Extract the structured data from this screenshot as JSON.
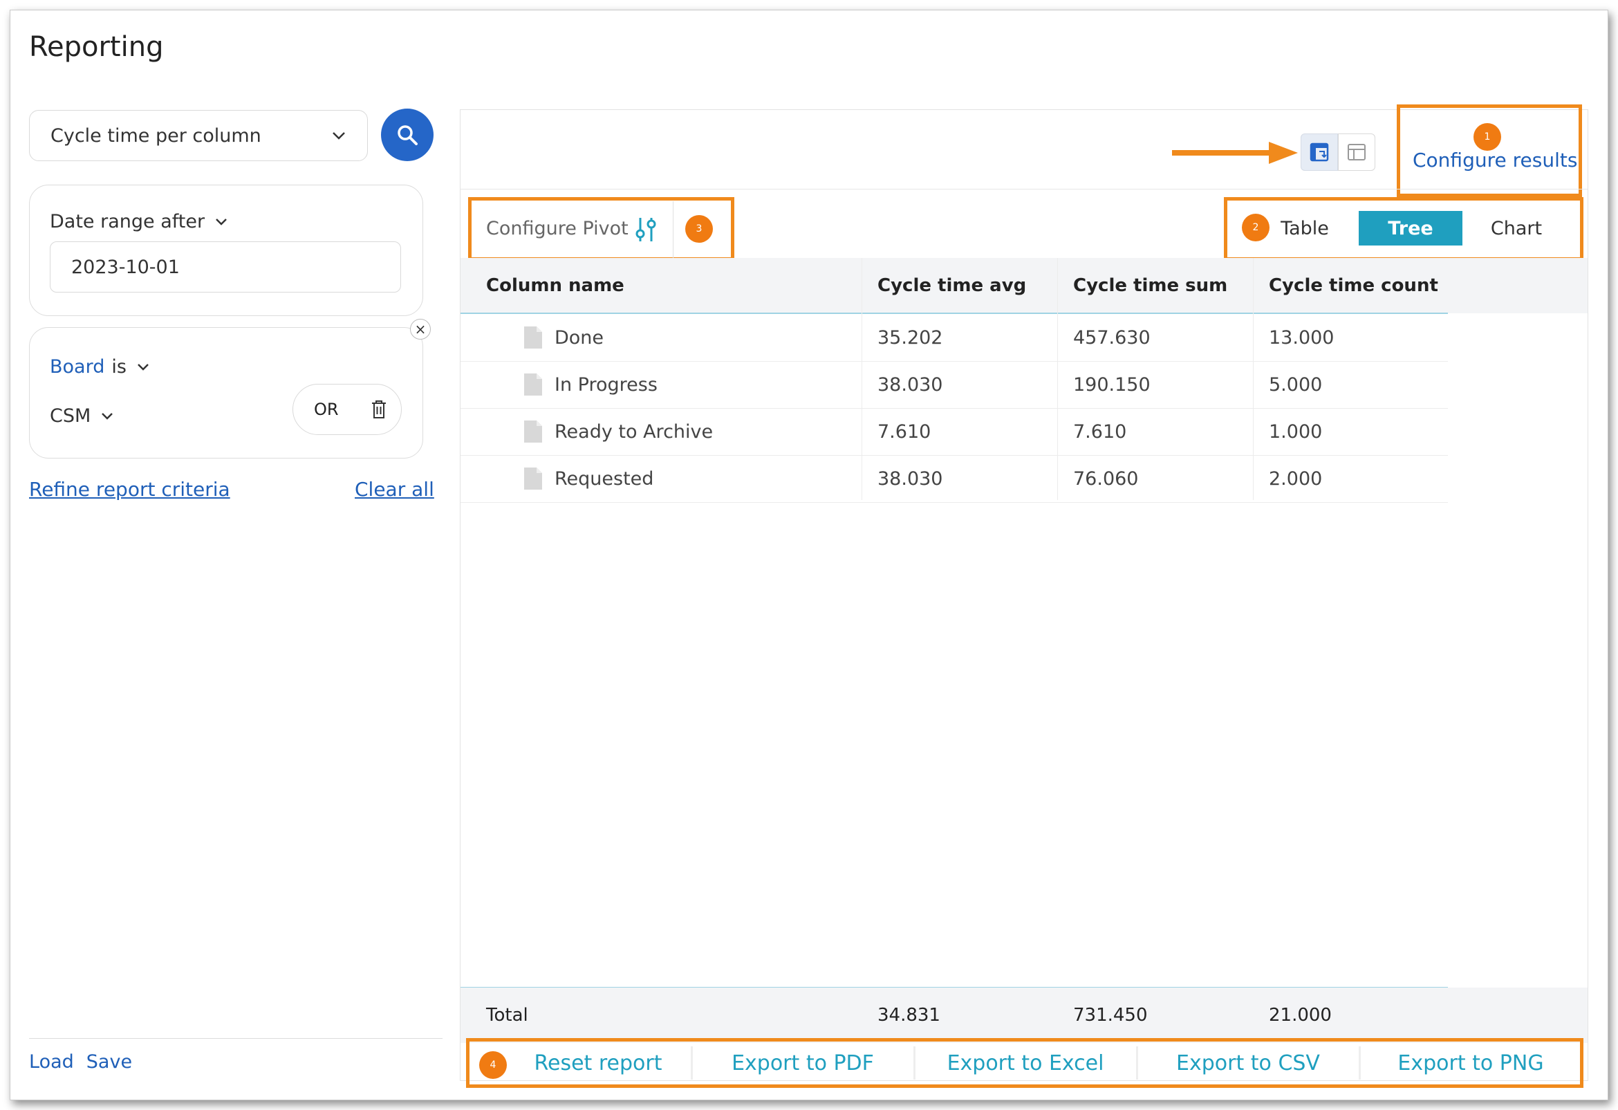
{
  "page": {
    "title": "Reporting"
  },
  "sidebar": {
    "report_select": "Cycle time per column",
    "date_filter": {
      "label": "Date range after",
      "value": "2023-10-01"
    },
    "board_filter": {
      "field": "Board",
      "operator": "is",
      "value": "CSM",
      "or_label": "OR"
    },
    "refine_link": "Refine report criteria",
    "clear_link": "Clear all",
    "load_label": "Load",
    "save_label": "Save"
  },
  "toolbar": {
    "configure_results": "Configure results",
    "configure_pivot": "Configure Pivot",
    "modes": [
      "Table",
      "Tree",
      "Chart"
    ],
    "active_mode": "Tree"
  },
  "badges": [
    "1",
    "2",
    "3",
    "4"
  ],
  "table": {
    "columns": [
      "Column name",
      "Cycle time avg",
      "Cycle time sum",
      "Cycle time count"
    ],
    "rows": [
      [
        "Done",
        "35.202",
        "457.630",
        "13.000"
      ],
      [
        "In Progress",
        "38.030",
        "190.150",
        "5.000"
      ],
      [
        "Ready to Archive",
        "7.610",
        "7.610",
        "1.000"
      ],
      [
        "Requested",
        "38.030",
        "76.060",
        "2.000"
      ]
    ],
    "total": [
      "Total",
      "34.831",
      "731.450",
      "21.000"
    ]
  },
  "actions": [
    "Reset report",
    "Export to PDF",
    "Export to Excel",
    "Export to CSV",
    "Export to PNG"
  ],
  "colors": {
    "accent": "#1f9fbf",
    "primary": "#2566c8",
    "highlight": "#f08a1c",
    "link": "#1f5fb8"
  }
}
